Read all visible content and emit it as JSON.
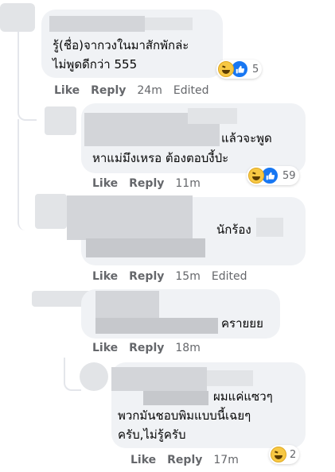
{
  "comments": [
    {
      "text_lines": [
        "รู้(ชื่อ)จากวงในมาสักพักล่ะ",
        "ไม่พูดดีกว่า 555"
      ],
      "actions": {
        "like": "Like",
        "reply": "Reply",
        "time": "24m",
        "edited": "Edited"
      },
      "reactions": {
        "icons": [
          "haha-icon",
          "like-icon"
        ],
        "count": "5"
      }
    },
    {
      "text_lines": [
        "แล้วจะพูด",
        "หาแม่มึงเหรอ ต้องตอบงี้ป่ะ"
      ],
      "actions": {
        "like": "Like",
        "reply": "Reply",
        "time": "11m"
      },
      "reactions": {
        "icons": [
          "haha-icon",
          "like-icon"
        ],
        "count": "59"
      }
    },
    {
      "text_lines": [
        "นักร้อง"
      ],
      "actions": {
        "like": "Like",
        "reply": "Reply",
        "time": "15m",
        "edited": "Edited"
      }
    },
    {
      "text_lines": [
        "คราย​ยย"
      ],
      "actions": {
        "like": "Like",
        "reply": "Reply",
        "time": "18m"
      }
    },
    {
      "text_lines": [
        "ผมแค่แซวๆ",
        "พวกมันชอบพิมแบบนี้เฉยๆ",
        "ครับ,ไม่รู้ครับ"
      ],
      "actions": {
        "like": "Like",
        "reply": "Reply",
        "time": "17m"
      },
      "reactions": {
        "icons": [
          "haha-icon"
        ],
        "count": "2"
      }
    }
  ],
  "colors": {
    "bubble": "#f0f2f5",
    "meta": "#65676b",
    "text": "#050505",
    "like_blue": "#1877f2",
    "haha_yellow": "#f7c844"
  }
}
